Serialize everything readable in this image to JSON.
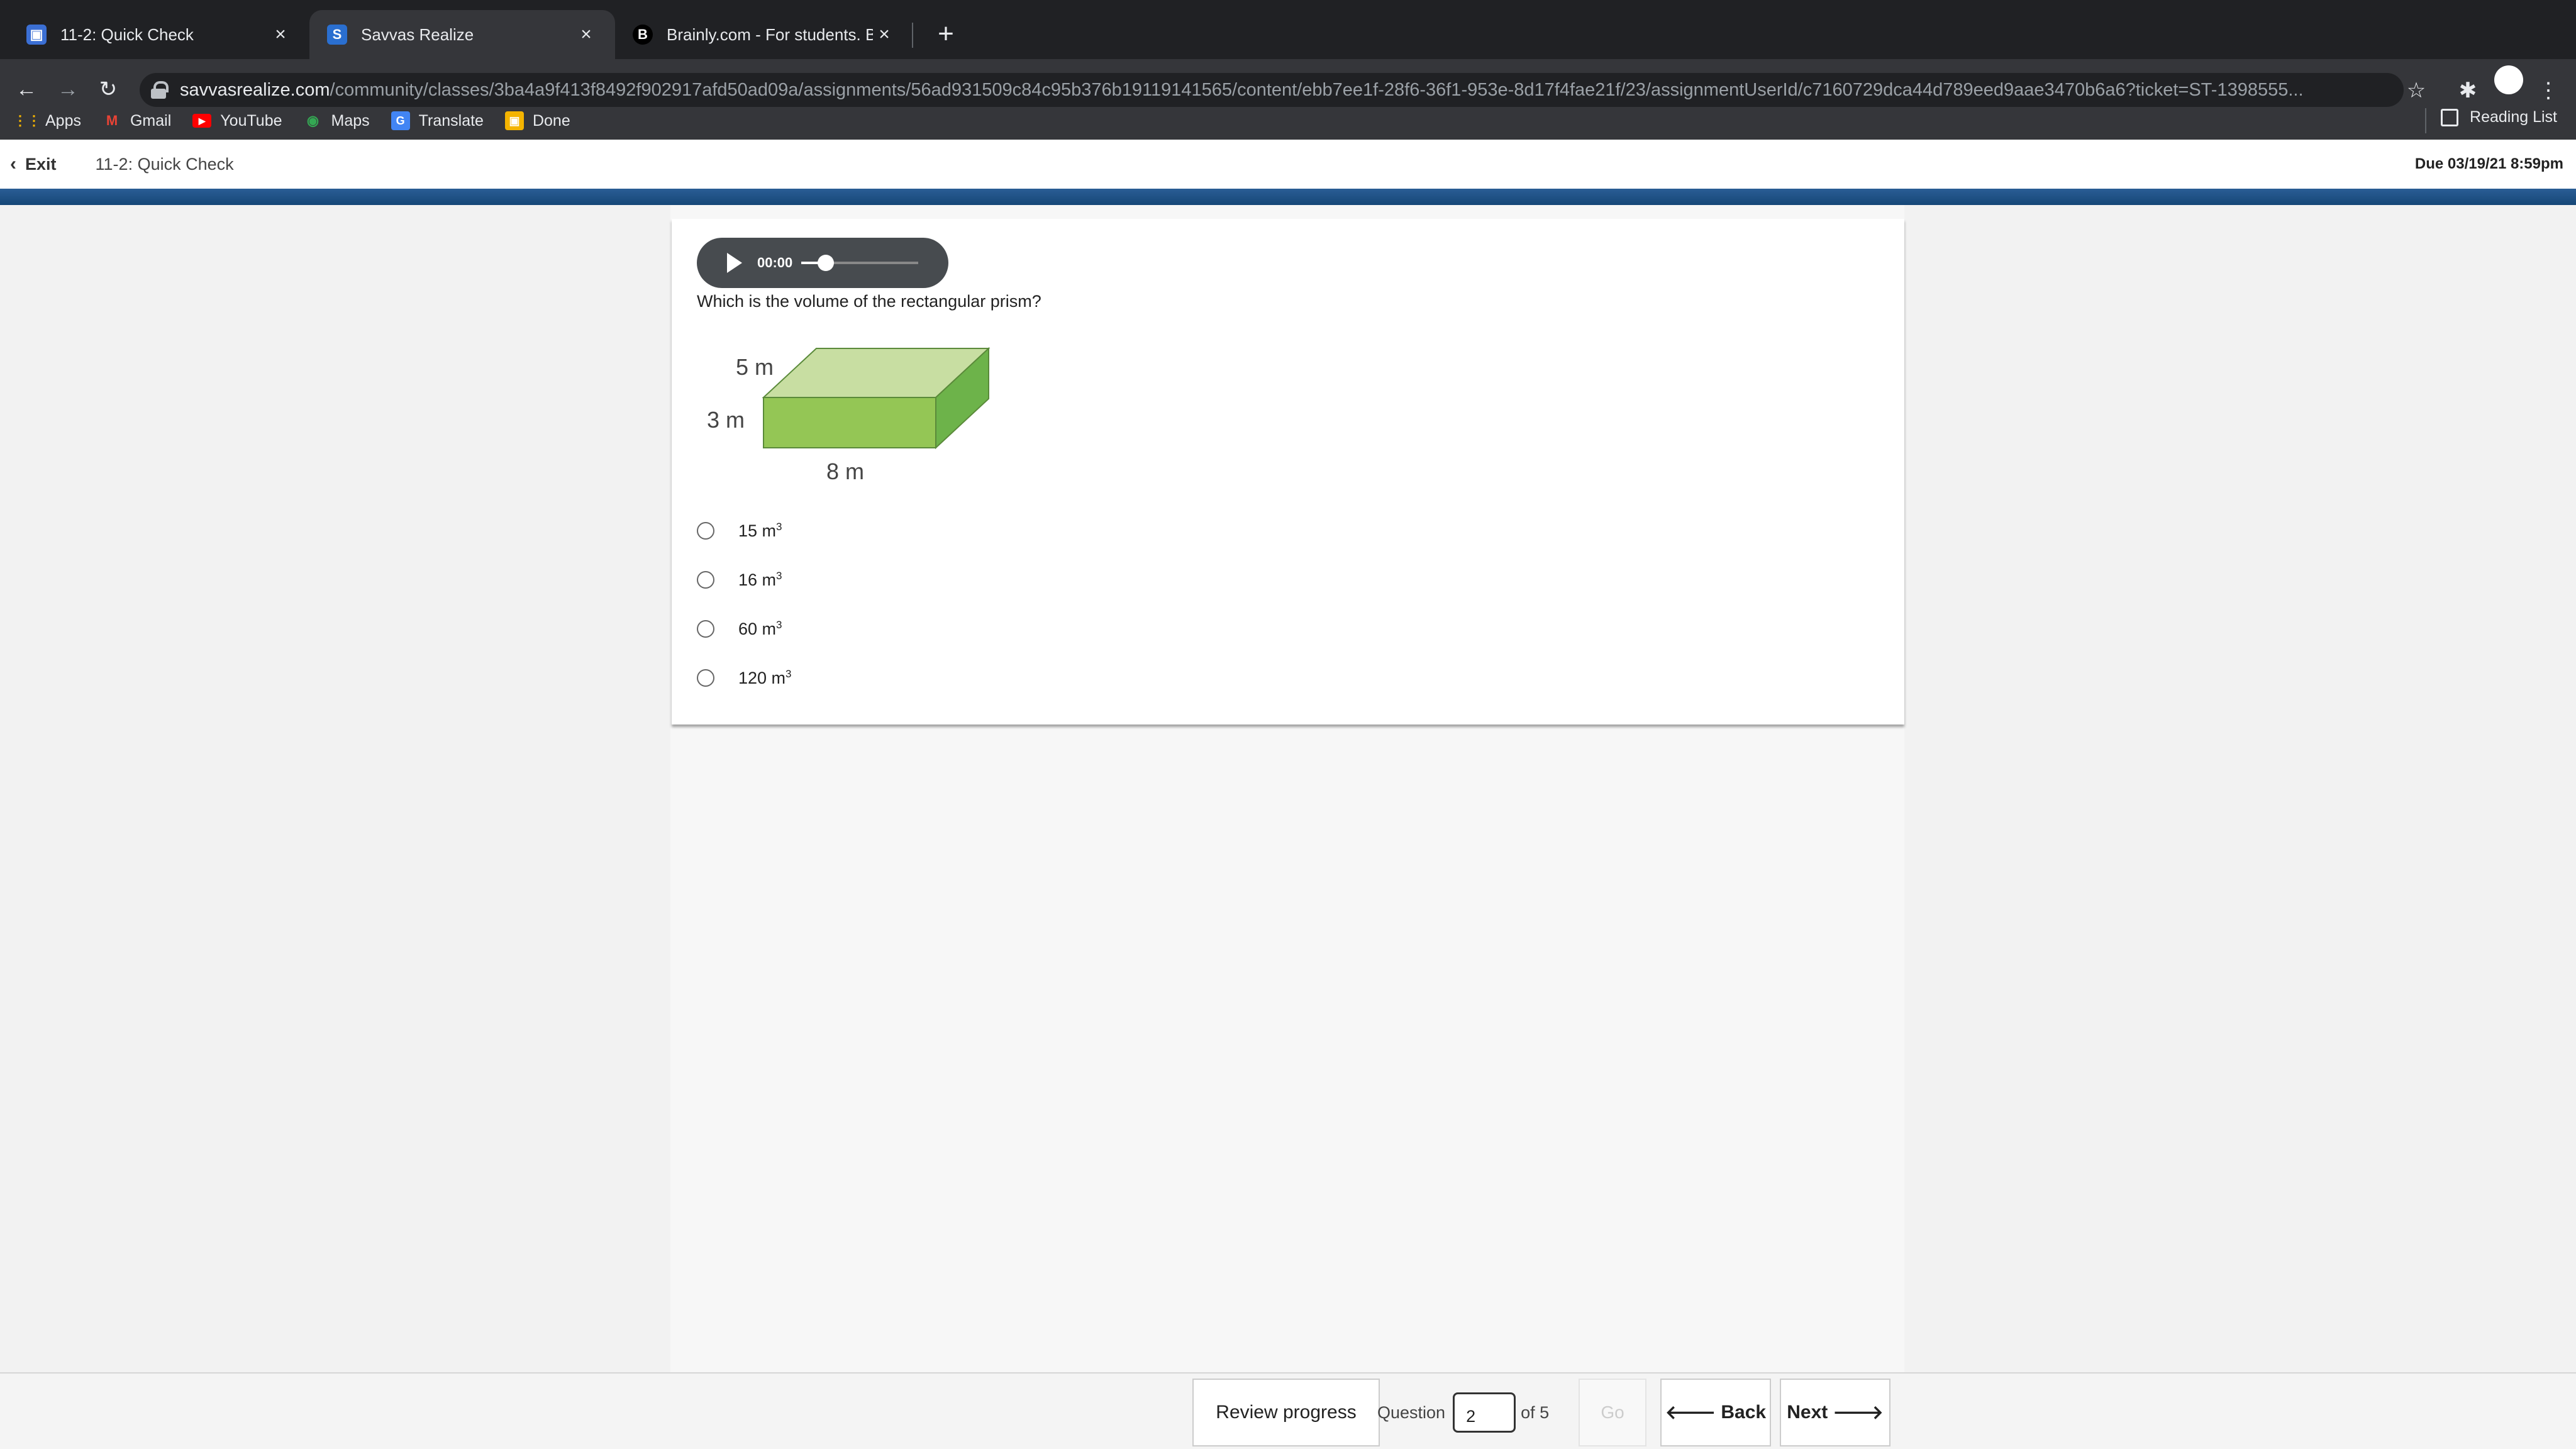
{
  "browser": {
    "tabs": [
      {
        "title": "11-2: Quick Check",
        "active": false
      },
      {
        "title": "Savvas Realize",
        "active": true
      },
      {
        "title": "Brainly.com - For students. By",
        "active": false
      }
    ],
    "url_host": "savvasrealize.com",
    "url_path": "/community/classes/3ba4a9f413f8492f902917afd50ad09a/assignments/56ad931509c84c95b376b19119141565/content/ebb7ee1f-28f6-36f1-953e-8d17f4fae21f/23/assignmentUserId/c7160729dca44d789eed9aae3470b6a6?ticket=ST-1398555...",
    "bookmarks": [
      "Apps",
      "Gmail",
      "YouTube",
      "Maps",
      "Translate",
      "Done"
    ],
    "reading_list": "Reading List"
  },
  "header": {
    "exit_label": "Exit",
    "title": "11-2: Quick Check",
    "due": "Due 03/19/21 8:59pm"
  },
  "audio": {
    "time": "00:00",
    "progress": 0.05
  },
  "question": {
    "text": "Which is the volume of the rectangular prism?",
    "figure_labels": {
      "depth": "5 m",
      "height": "3 m",
      "width": "8 m"
    },
    "options": [
      {
        "value": "15 m",
        "exp": "3"
      },
      {
        "value": "16 m",
        "exp": "3"
      },
      {
        "value": "60 m",
        "exp": "3"
      },
      {
        "value": "120 m",
        "exp": "3"
      }
    ]
  },
  "footer": {
    "review_label": "Review progress",
    "question_label": "Question",
    "current": "2",
    "of_label": "of 5",
    "go_label": "Go",
    "back_label": "Back",
    "next_label": "Next"
  },
  "colors": {
    "tabbar": "#202124",
    "toolbar": "#35363a",
    "header_bar": "#1f4f82",
    "prism_front": "#94c655",
    "prism_top": "#c8dea2",
    "prism_side": "#6db34a"
  }
}
